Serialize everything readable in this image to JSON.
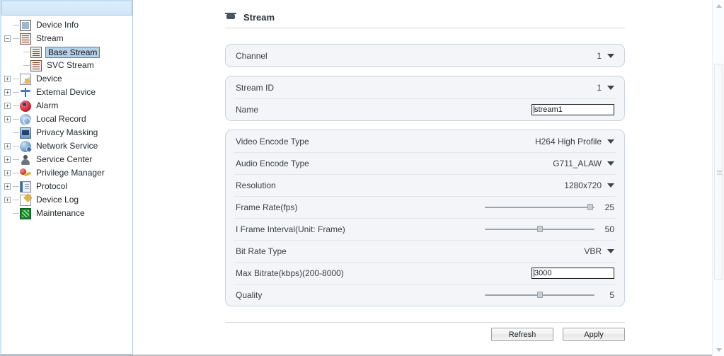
{
  "sidebar": {
    "items": [
      {
        "label": "Device Info",
        "icon": "document-icon",
        "level": 1,
        "toggle": "none"
      },
      {
        "label": "Stream",
        "icon": "stream-icon",
        "level": 1,
        "toggle": "minus"
      },
      {
        "label": "Base Stream",
        "icon": "stream-icon",
        "level": 2,
        "toggle": "none",
        "selected": true
      },
      {
        "label": "SVC Stream",
        "icon": "stream-icon",
        "level": 2,
        "toggle": "none"
      },
      {
        "label": "Device",
        "icon": "device-icon",
        "level": 1,
        "toggle": "plus"
      },
      {
        "label": "External Device",
        "icon": "external-device-icon",
        "level": 1,
        "toggle": "plus"
      },
      {
        "label": "Alarm",
        "icon": "alarm-icon",
        "level": 1,
        "toggle": "plus"
      },
      {
        "label": "Local Record",
        "icon": "local-record-icon",
        "level": 1,
        "toggle": "plus"
      },
      {
        "label": "Privacy Masking",
        "icon": "privacy-masking-icon",
        "level": 1,
        "toggle": "none"
      },
      {
        "label": "Network Service",
        "icon": "network-service-icon",
        "level": 1,
        "toggle": "plus"
      },
      {
        "label": "Service Center",
        "icon": "service-center-icon",
        "level": 1,
        "toggle": "plus"
      },
      {
        "label": "Privilege Manager",
        "icon": "privilege-manager-icon",
        "level": 1,
        "toggle": "plus"
      },
      {
        "label": "Protocol",
        "icon": "protocol-icon",
        "level": 1,
        "toggle": "plus"
      },
      {
        "label": "Device Log",
        "icon": "device-log-icon",
        "level": 1,
        "toggle": "plus"
      },
      {
        "label": "Maintenance",
        "icon": "maintenance-icon",
        "level": 1,
        "toggle": "none"
      }
    ]
  },
  "page": {
    "title": "Stream",
    "icon": "stream-page-icon"
  },
  "channel_panel": {
    "label": "Channel",
    "value": "1"
  },
  "stream_panel": {
    "stream_id_label": "Stream ID",
    "stream_id_value": "1",
    "name_label": "Name",
    "name_value": "stream1"
  },
  "encode_panel": {
    "video_encode_label": "Video Encode Type",
    "video_encode_value": "H264 High Profile",
    "audio_encode_label": "Audio Encode Type",
    "audio_encode_value": "G711_ALAW",
    "resolution_label": "Resolution",
    "resolution_value": "1280x720",
    "frame_rate_label": "Frame Rate(fps)",
    "frame_rate_value": "25",
    "frame_rate_pct": 96,
    "i_frame_label": "I Frame Interval(Unit: Frame)",
    "i_frame_value": "50",
    "i_frame_pct": 50,
    "bit_rate_type_label": "Bit Rate Type",
    "bit_rate_type_value": "VBR",
    "max_bitrate_label": "Max Bitrate(kbps)(200-8000)",
    "max_bitrate_value": "3000",
    "quality_label": "Quality",
    "quality_value": "5",
    "quality_pct": 50
  },
  "footer": {
    "refresh_label": "Refresh",
    "apply_label": "Apply"
  },
  "colors": {
    "panel_bg": "#f3f5f8",
    "panel_border": "#cdd3da",
    "selection": "#b8cfe6",
    "sidebar_border": "#a9cbe4",
    "text": "#3a3f47"
  }
}
